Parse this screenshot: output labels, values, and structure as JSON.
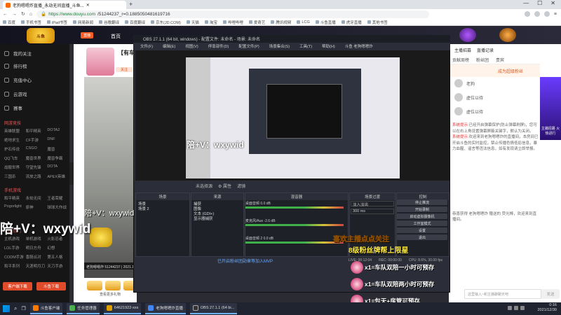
{
  "browser": {
    "tab_title": "老狗嗯嗯炸直播_永劫无间直播_斗鱼...",
    "new_tab": "+",
    "url_host": "https://www.douyu.com",
    "url_rest": "/51244237_r=0.1885050481619716",
    "win_controls": [
      "—",
      "☐",
      "✕"
    ],
    "bookmarks": [
      "百度",
      "手机书签",
      "iPad书签",
      "网易新闻",
      "谷歌翻译",
      "百度翻译",
      "京东(JD.COM)",
      "天猫",
      "淘宝",
      "哔哩哔哩",
      "爱奇艺",
      "腾讯视频",
      "LCG",
      "斗鱼直播",
      "虎牙直播",
      "其他书签"
    ]
  },
  "site": {
    "logo_text": "斗鱼",
    "live_label": "直播",
    "nav_home": "首页",
    "sidebar_items": [
      "我的关注",
      "排行榜",
      "充值中心",
      "云游戏",
      "赛事"
    ],
    "section_hot": "网游竞技",
    "hot_games": [
      "英雄联盟",
      "和平精英",
      "DOTA2",
      "绝地求生",
      "CF手游",
      "DNF",
      "炉石传说",
      "CSGO",
      "魔兽",
      "QQ飞车",
      "魔兽世界",
      "魔兽争霸",
      "战舰世界",
      "守望先锋",
      "DOTA",
      "三国杀",
      "流放之路",
      "APEX英雄"
    ],
    "section_mobile": "手机游戏",
    "mobile_games": [
      "和平精英",
      "永劫无间",
      "王者荣耀",
      "Pogorlight",
      "原神",
      "球球大作战"
    ],
    "section_more": "单机热门",
    "more_games": [
      "主机游戏",
      "单机游戏",
      "火影忍者",
      "LOL手游",
      "明日方舟",
      "幻想",
      "CODM手游",
      "香肠派对",
      "第五人格",
      "和平系列",
      "天涯明月刀",
      "天刀手游"
    ],
    "sidebar_btn_1": "客户端下载",
    "sidebar_btn_2": "斗鱼下载",
    "room_title": "【有车位】",
    "follow_tag": "关注",
    "video_info": "老狗嗯嗯炸  51244237 | 2021.12.30",
    "gift_text": "查看更多礼物"
  },
  "right_panel": {
    "top_tabs": [
      "主播招募",
      "直播记录"
    ],
    "tabs": [
      "贡献周榜",
      "粉丝团",
      "贵宾"
    ],
    "banner": "成为超级粉丝",
    "fans": [
      "老狗",
      "虚位以待",
      "虚位以待"
    ],
    "notice_label": "系统提示:",
    "notice_text": "已经开启弹幕保护(防止弹幕刷屏)，您可以在右上角设置弹幕屏蔽关键字，默认为关闭。",
    "notice2_label": "系统提示:",
    "notice2_text": "欢迎来到老狗嗯嗯炸的直播间，本房间已开启斗鱼的实时监控，禁止传播色情低俗信息，暴力血腥、谣言等违法信息，如有发现请立即举报。",
    "notice3_text": "恭喜获得 老狗嗯嗯炸 赠送的 荧光棒，欢迎来到直播间。",
    "badge_text": "主播招募 火热进行",
    "chat_placeholder": "这里输入~和主播聊聊天吧",
    "send_label": "发送"
  },
  "obs": {
    "title": "OBS 27.1.1 (64 bit, windows) - 配置文件: 未命名 - 场景: 未命名",
    "menu": [
      "文件(F)",
      "编辑(E)",
      "视图(V)",
      "停靠部件(D)",
      "配置文件(P)",
      "场景集合(S)",
      "工具(T)",
      "帮助(H)",
      "斗鱼 老狗嗯嗯炸"
    ],
    "controls": [
      "未选择源",
      "⚙ 属性",
      "滤镜"
    ],
    "panels": {
      "scenes_header": "场景",
      "scenes": [
        "场景",
        "场景 2"
      ],
      "sources_header": "来源",
      "sources": [
        "捕获",
        "图像",
        "文本 (GDI+)",
        "显示器捕获"
      ],
      "mixer_header": "混音器",
      "mixer_rows": [
        "桌面音频",
        "麦克风/Aux",
        "桌面音频 2"
      ],
      "mixer_values": [
        "0.0 dB",
        "-2.6 dB",
        "0.0 dB"
      ],
      "transition_header": "场景过渡",
      "transition_type": "淡入淡出",
      "transition_duration": "300 ms",
      "controls_header": "控制",
      "control_buttons": [
        "停止推流",
        "开始录制",
        "启动虚拟摄像机",
        "工作室模式",
        "设置",
        "退出"
      ]
    },
    "status": [
      "LIVE: 00:12:04",
      "REC: 00:00:00",
      "CPU: 8.6%, 30.00 fps"
    ]
  },
  "overlays": {
    "big_contact": "陪+V：wxywid",
    "small_contact": "陪+V：wxywid",
    "preview_contact": "陪+V：wxywid",
    "banner_line1": "喜欢主播点点关注",
    "banner_line2": "8级粉丝牌帮上限星",
    "blue_text": "已开启粉丝团勋章等加入MVP",
    "gift_lines": [
      "x1=车队双陪一小时可预存",
      "x1=车队双陪两小时可预存",
      "x1=包天+房管可预存"
    ]
  },
  "taskbar": {
    "apps": [
      "斗鱼客户端",
      "任务管理器",
      "64621922-xxx",
      "老狗嗯嗯炸直播",
      "OBS 27.1.1 (64 bi..."
    ],
    "time": "0:16",
    "date": "2021/12/30"
  },
  "colors": {
    "brand_orange": "#ff5d23",
    "obs_bg": "#2b2e38",
    "banner_yellow": "#ffeb3b"
  }
}
